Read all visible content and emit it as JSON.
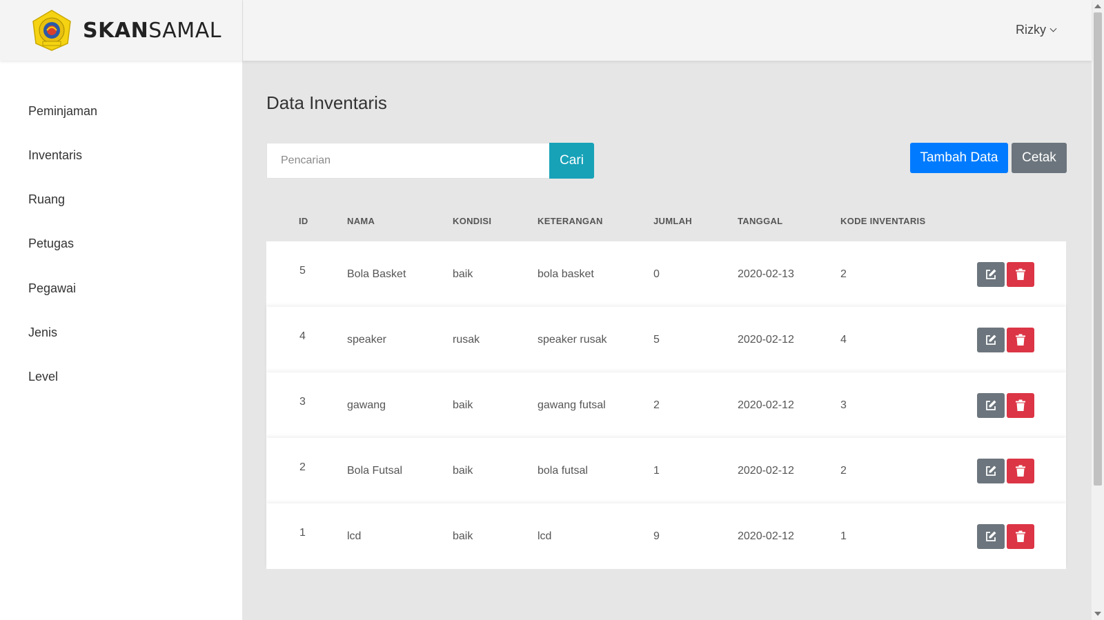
{
  "brand": {
    "name_bold": "SKAN",
    "name_rest": "SAMAL",
    "logo_icon": "school-crest-icon"
  },
  "header": {
    "user_name": "Rizky"
  },
  "sidebar": {
    "items": [
      {
        "label": "Peminjaman"
      },
      {
        "label": "Inventaris"
      },
      {
        "label": "Ruang"
      },
      {
        "label": "Petugas"
      },
      {
        "label": "Pegawai"
      },
      {
        "label": "Jenis"
      },
      {
        "label": "Level"
      }
    ]
  },
  "main": {
    "title": "Data Inventaris",
    "search": {
      "placeholder": "Pencarian",
      "value": "",
      "button_label": "Cari"
    },
    "actions": {
      "add_label": "Tambah Data",
      "print_label": "Cetak"
    },
    "table": {
      "headers": {
        "id": "ID",
        "nama": "NAMA",
        "kondisi": "KONDISI",
        "keterangan": "KETERANGAN",
        "jumlah": "JUMLAH",
        "tanggal": "TANGGAL",
        "kode": "KODE INVENTARIS"
      },
      "rows": [
        {
          "id": "5",
          "nama": "Bola Basket",
          "kondisi": "baik",
          "keterangan": "bola basket",
          "jumlah": "0",
          "tanggal": "2020-02-13",
          "kode": "2"
        },
        {
          "id": "4",
          "nama": "speaker",
          "kondisi": "rusak",
          "keterangan": "speaker rusak",
          "jumlah": "5",
          "tanggal": "2020-02-12",
          "kode": "4"
        },
        {
          "id": "3",
          "nama": "gawang",
          "kondisi": "baik",
          "keterangan": "gawang futsal",
          "jumlah": "2",
          "tanggal": "2020-02-12",
          "kode": "3"
        },
        {
          "id": "2",
          "nama": "Bola Futsal",
          "kondisi": "baik",
          "keterangan": "bola futsal",
          "jumlah": "1",
          "tanggal": "2020-02-12",
          "kode": "2"
        },
        {
          "id": "1",
          "nama": "lcd",
          "kondisi": "baik",
          "keterangan": "lcd",
          "jumlah": "9",
          "tanggal": "2020-02-12",
          "kode": "1"
        }
      ],
      "row_actions": {
        "edit_icon": "edit-icon",
        "delete_icon": "trash-icon"
      }
    }
  },
  "colors": {
    "primary": "#007bff",
    "info": "#17a2b8",
    "secondary": "#6c757d",
    "danger": "#dc3545",
    "content_bg": "#e6e6e6",
    "header_bg": "#f4f4f4"
  }
}
